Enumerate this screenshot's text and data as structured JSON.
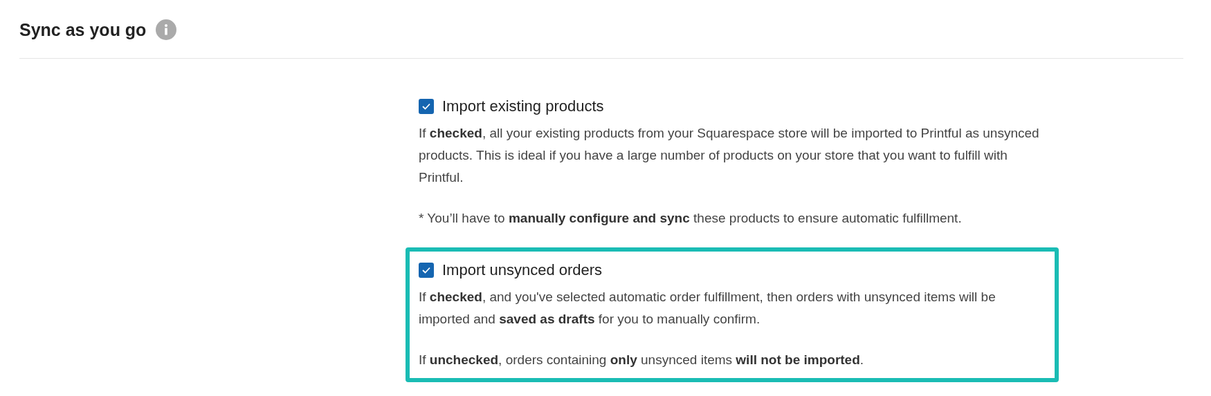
{
  "section": {
    "title": "Sync as you go"
  },
  "options": [
    {
      "label": "Import existing products",
      "checked": true,
      "highlighted": false,
      "paragraphs": [
        "If **checked**, all your existing products from your Squarespace store will be imported to Printful as unsynced products. This is ideal if you have a large number of products on your store that you want to fulfill with Printful.",
        "* You’ll have to **manually configure and sync** these products to ensure automatic fulfillment."
      ]
    },
    {
      "label": "Import unsynced orders",
      "checked": true,
      "highlighted": true,
      "paragraphs": [
        "If **checked**, and you've selected automatic order fulfillment, then orders with unsynced items will be imported and **saved as drafts** for you to manually confirm.",
        "If **unchecked**, orders containing **only** unsynced items **will not be imported**."
      ]
    }
  ]
}
